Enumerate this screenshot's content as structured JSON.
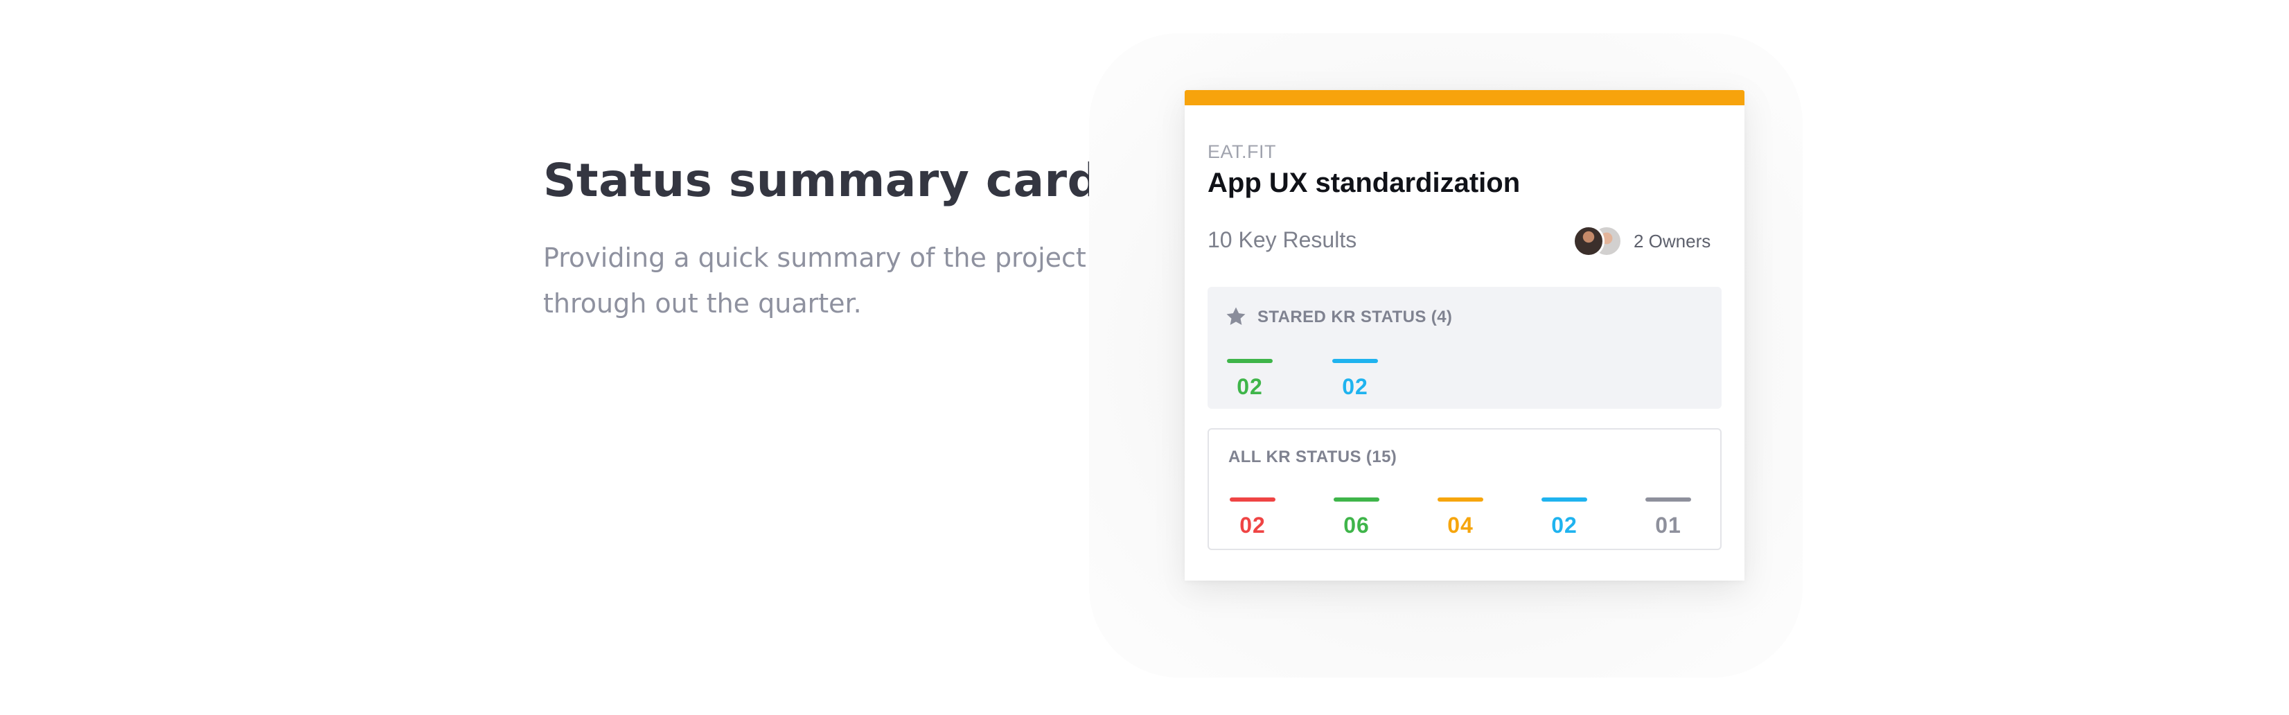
{
  "intro": {
    "heading": "Status summary card",
    "description": "Providing a quick summary of the project through out the quarter."
  },
  "card": {
    "accent_color": "#f7a30c",
    "org": "EAT.FIT",
    "title": "App UX standardization",
    "key_results": "10 Key Results",
    "owners_label": "2 Owners",
    "stared": {
      "title": "STARED KR STATUS (4)",
      "icon": "star-icon",
      "items": [
        {
          "value": "02",
          "color": "#3fb54a"
        },
        {
          "value": "02",
          "color": "#1fb3ef"
        }
      ]
    },
    "all": {
      "title": "ALL KR STATUS (15)",
      "items": [
        {
          "value": "02",
          "color": "#ef4444"
        },
        {
          "value": "06",
          "color": "#3fb54a"
        },
        {
          "value": "04",
          "color": "#f6a50d"
        },
        {
          "value": "02",
          "color": "#1fb3ef"
        },
        {
          "value": "01",
          "color": "#8e909c"
        }
      ]
    }
  }
}
